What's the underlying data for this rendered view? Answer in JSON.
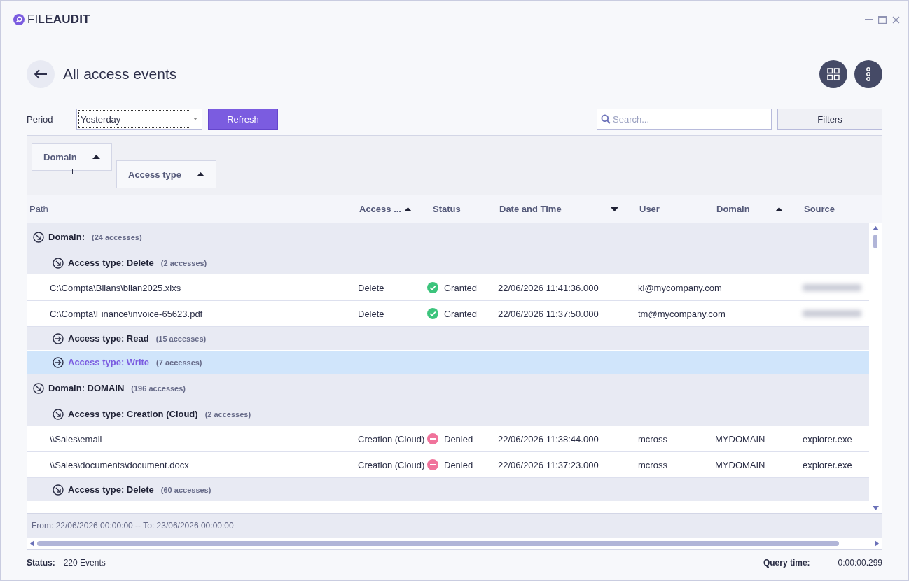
{
  "window": {
    "logo_light": "FILE",
    "logo_bold": "AUDIT"
  },
  "page": {
    "title": "All access events"
  },
  "toolbar": {
    "period_label": "Period",
    "period_value": "Yesterday",
    "refresh": "Refresh",
    "search_placeholder": "Search...",
    "filters": "Filters"
  },
  "grouping": [
    {
      "label": "Domain"
    },
    {
      "label": "Access type"
    }
  ],
  "columns": [
    {
      "label": "Path",
      "sorted_ascending": false,
      "sorted_descending": false
    },
    {
      "label": "Access ...",
      "sorted_ascending": true,
      "sorted_descending": false
    },
    {
      "label": "Status",
      "sorted_ascending": false,
      "sorted_descending": false
    },
    {
      "label": "Date and Time",
      "sorted_ascending": false,
      "sorted_descending": true
    },
    {
      "label": "User",
      "sorted_ascending": false,
      "sorted_descending": false
    },
    {
      "label": "Domain",
      "sorted_ascending": true,
      "sorted_descending": false
    },
    {
      "label": "Source",
      "sorted_ascending": false,
      "sorted_descending": false
    }
  ],
  "groups": [
    {
      "title": "Domain:",
      "count": "(24 accesses)",
      "expanded": true,
      "selected": false,
      "children": [
        {
          "title": "Access type: Delete",
          "count": "(2 accesses)",
          "expanded": true,
          "selected": false,
          "rows": [
            {
              "path": "C:\\Compta\\Bilans\\bilan2025.xlxs",
              "access": "Delete",
              "status": {
                "kind": "granted",
                "label": "Granted"
              },
              "date": "22/06/2026 11:41:36.000",
              "user": "kl@mycompany.com",
              "source_blurred": true
            },
            {
              "path": "C:\\Compta\\Finance\\invoice-65623.pdf",
              "access": "Delete",
              "status": {
                "kind": "granted",
                "label": "Granted"
              },
              "date": "22/06/2026 11:37:50.000",
              "user": "tm@mycompany.com",
              "source_blurred": true
            }
          ]
        },
        {
          "title": "Access type: Read",
          "count": "(15 accesses)",
          "expanded": false,
          "selected": false
        },
        {
          "title": "Access type: Write",
          "count": "(7 accesses)",
          "expanded": false,
          "selected": true
        }
      ]
    },
    {
      "title": "Domain: DOMAIN",
      "count": "(196 accesses)",
      "expanded": true,
      "selected": false,
      "children": [
        {
          "title": "Access type: Creation (Cloud)",
          "count": "(2 accesses)",
          "expanded": true,
          "selected": false,
          "rows": [
            {
              "path": "\\\\Sales\\email",
              "access": "Creation (Cloud)",
              "status": {
                "kind": "denied",
                "label": "Denied"
              },
              "date": "22/06/2026 11:38:44.000",
              "user": "mcross",
              "domain": "MYDOMAIN",
              "source": "explorer.exe",
              "source_blurred": false
            },
            {
              "path": "\\\\Sales\\documents\\document.docx",
              "access": "Creation (Cloud)",
              "status": {
                "kind": "denied",
                "label": "Denied"
              },
              "date": "22/06/2026 11:37:23.000",
              "user": "mcross",
              "domain": "MYDOMAIN",
              "source": "explorer.exe",
              "source_blurred": false
            }
          ]
        },
        {
          "title": "Access type: Delete",
          "count": "(60 accesses)",
          "expanded": true,
          "selected": false
        }
      ]
    }
  ],
  "footer": {
    "range": "From: 22/06/2026 00:00:00 -- To: 23/06/2026 00:00:00"
  },
  "status_bar": {
    "status_label": "Status:",
    "status_value": "220 Events",
    "query_label": "Query time:",
    "query_value": "0:00:00.299"
  }
}
